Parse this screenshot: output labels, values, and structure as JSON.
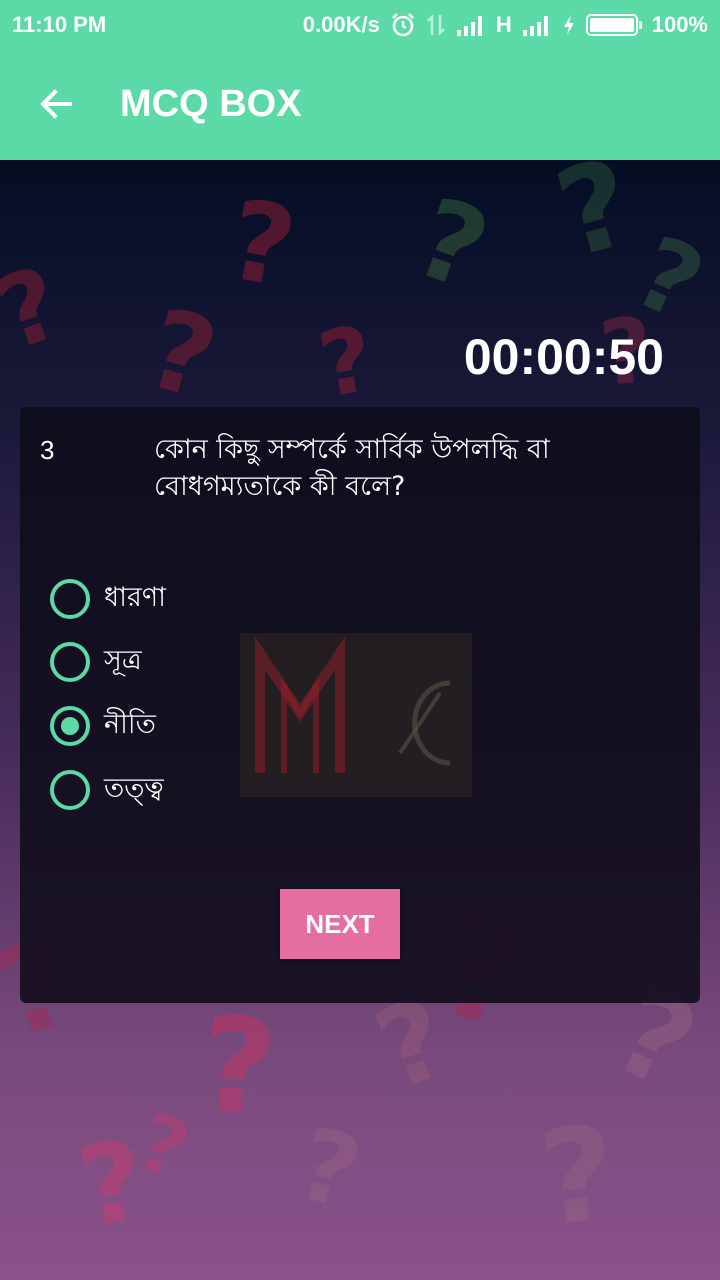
{
  "status_bar": {
    "time": "11:10 PM",
    "network_speed": "0.00K/s",
    "network_type": "H",
    "battery": "100%"
  },
  "app_bar": {
    "title": "MCQ BOX",
    "back_icon": "arrow-left-icon"
  },
  "quiz": {
    "timer": "00:00:50",
    "question_number": "3",
    "question_text": "কোন কিছু সম্পর্কে সার্বিক উপলদ্ধি বা বোধগম্যতাকে কী বলে?",
    "options": [
      {
        "label": "ধারণা",
        "selected": false
      },
      {
        "label": "সূত্র",
        "selected": false
      },
      {
        "label": "নীতি",
        "selected": true
      },
      {
        "label": "তত্ত্ব",
        "selected": false
      }
    ],
    "next_label": "NEXT"
  },
  "colors": {
    "accent": "#5bd9a6",
    "button": "#e46ea0"
  }
}
